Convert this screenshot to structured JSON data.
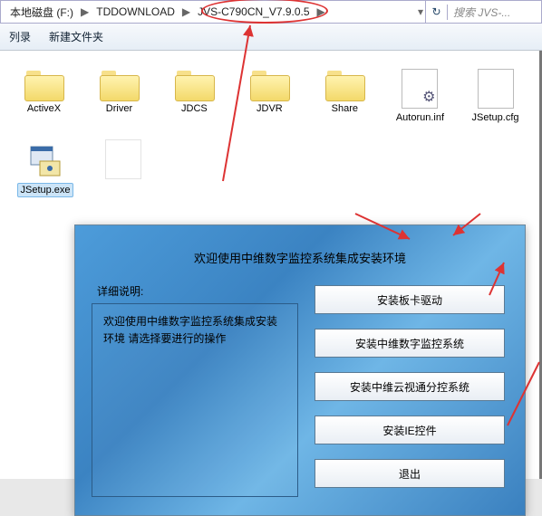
{
  "breadcrumb": {
    "drive": "本地磁盘 (F:)",
    "folder1": "TDDOWNLOAD",
    "folder2": "JVS-C790CN_V7.9.0.5"
  },
  "search": {
    "placeholder": "搜索 JVS-..."
  },
  "toolbar": {
    "organize": "列录",
    "newfolder": "新建文件夹"
  },
  "files": {
    "row1": [
      {
        "label": "ActiveX",
        "type": "folder"
      },
      {
        "label": "Driver",
        "type": "folder"
      },
      {
        "label": "JDCS",
        "type": "folder"
      },
      {
        "label": "JDVR",
        "type": "folder"
      },
      {
        "label": "Share",
        "type": "folder"
      },
      {
        "label": "Autorun.inf",
        "type": "cfg"
      },
      {
        "label": "JSetup.cfg",
        "type": "blank"
      }
    ],
    "row2": [
      {
        "label": "JSetup.exe",
        "type": "exe",
        "selected": true
      },
      {
        "label": "",
        "type": "blank"
      }
    ]
  },
  "installer": {
    "title": "欢迎使用中维数字监控系统集成安装环境",
    "detail_label": "详细说明:",
    "detail_text": "欢迎使用中维数字监控系统集成安装环境  请选择要进行的操作",
    "buttons": {
      "b1": "安装板卡驱动",
      "b2": "安装中维数字监控系统",
      "b3": "安装中维云视通分控系统",
      "b4": "安装IE控件",
      "b5": "退出"
    }
  }
}
